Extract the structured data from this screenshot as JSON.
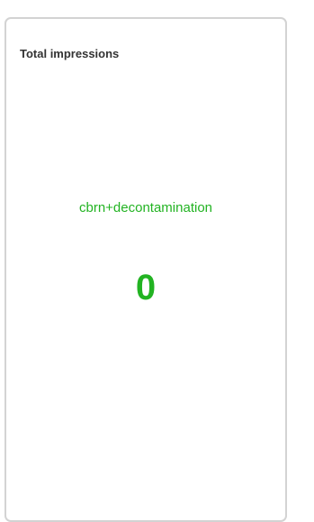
{
  "card": {
    "title": "Total impressions",
    "metric_label": "cbrn+decontamination",
    "metric_value": "0"
  },
  "colors": {
    "accent": "#22b322",
    "title_text": "#333333",
    "border": "#d3d3d3",
    "background": "#ffffff"
  }
}
